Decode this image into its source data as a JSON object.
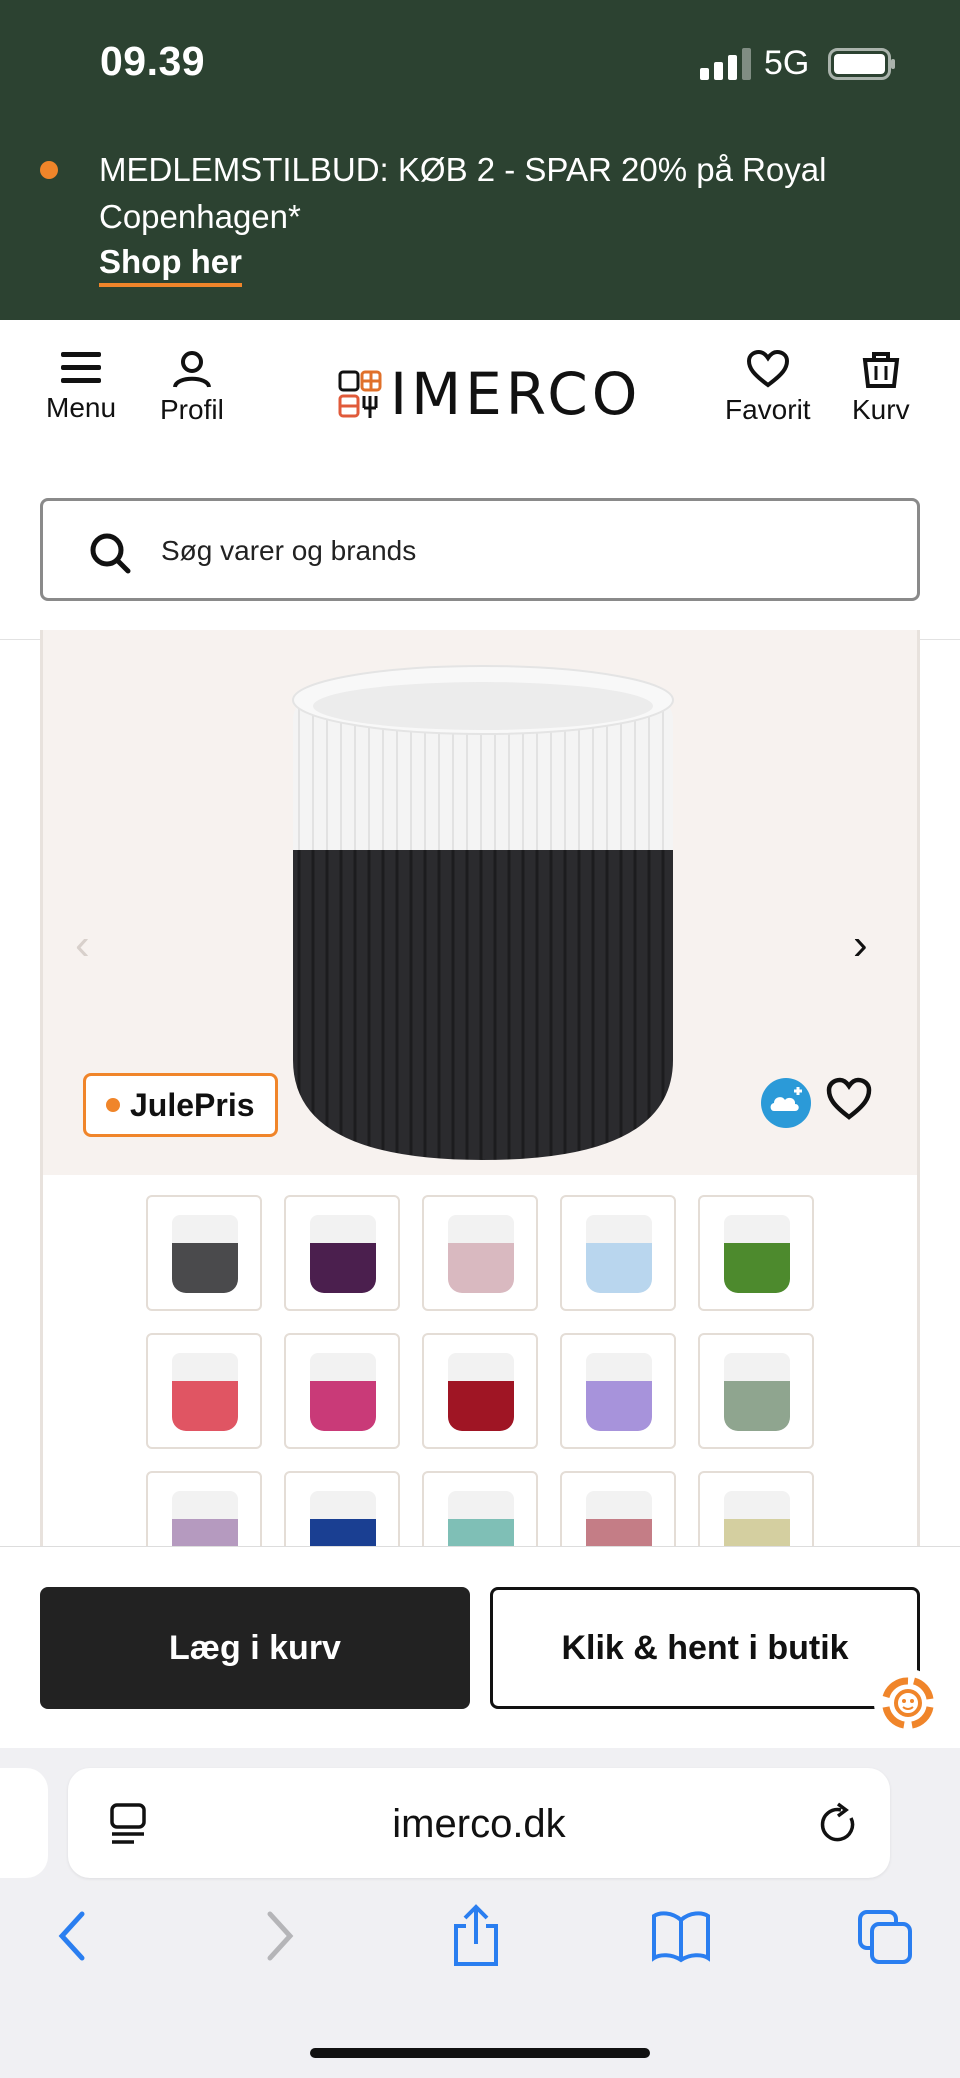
{
  "status_bar": {
    "time": "09.39",
    "network": "5G"
  },
  "promo": {
    "text": "MEDLEMSTILBUD: KØB 2 - SPAR 20% på Royal Copenhagen*",
    "link": "Shop her",
    "accent": "#f0852a",
    "background": "#2c4231"
  },
  "header": {
    "menu_label": "Menu",
    "profile_label": "Profil",
    "logo_text": "IMERCO",
    "favorite_label": "Favorit",
    "cart_label": "Kurv"
  },
  "search": {
    "placeholder": "Søg varer og brands"
  },
  "product": {
    "badge": "JulePris",
    "gallery_icons": {
      "prev": "chevron-left-icon",
      "next": "chevron-right-icon"
    },
    "thumbnail_colors": [
      "#4a4a4c",
      "#4b1f4e",
      "#d9b9c0",
      "#b9d6ee",
      "#4d8a2d",
      "#e05563",
      "#c93a78",
      "#9f1524",
      "#a793db",
      "#8fa58f",
      "#b59abf",
      "#1a3f92",
      "#7fbfb6",
      "#c47d86",
      "#d4cfa0"
    ]
  },
  "actions": {
    "add_to_cart": "Læg i kurv",
    "click_collect": "Klik & hent i butik"
  },
  "browser": {
    "url": "imerco.dk"
  }
}
